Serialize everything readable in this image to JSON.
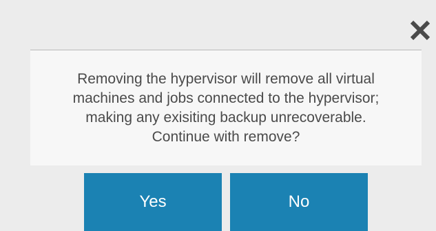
{
  "dialog": {
    "close_icon": "close-icon",
    "message": "Removing the hypervisor will remove all virtual\nmachines and jobs connected to the hypervisor;\nmaking any exisiting backup unrecoverable.\nContinue with remove?",
    "yes_label": "Yes",
    "no_label": "No"
  },
  "colors": {
    "background": "#ececec",
    "message_background": "#f7f7f7",
    "button": "#1b82b3",
    "button_text": "#ffffff",
    "text": "#4a4a4a",
    "close_icon": "#4a4a4a"
  }
}
